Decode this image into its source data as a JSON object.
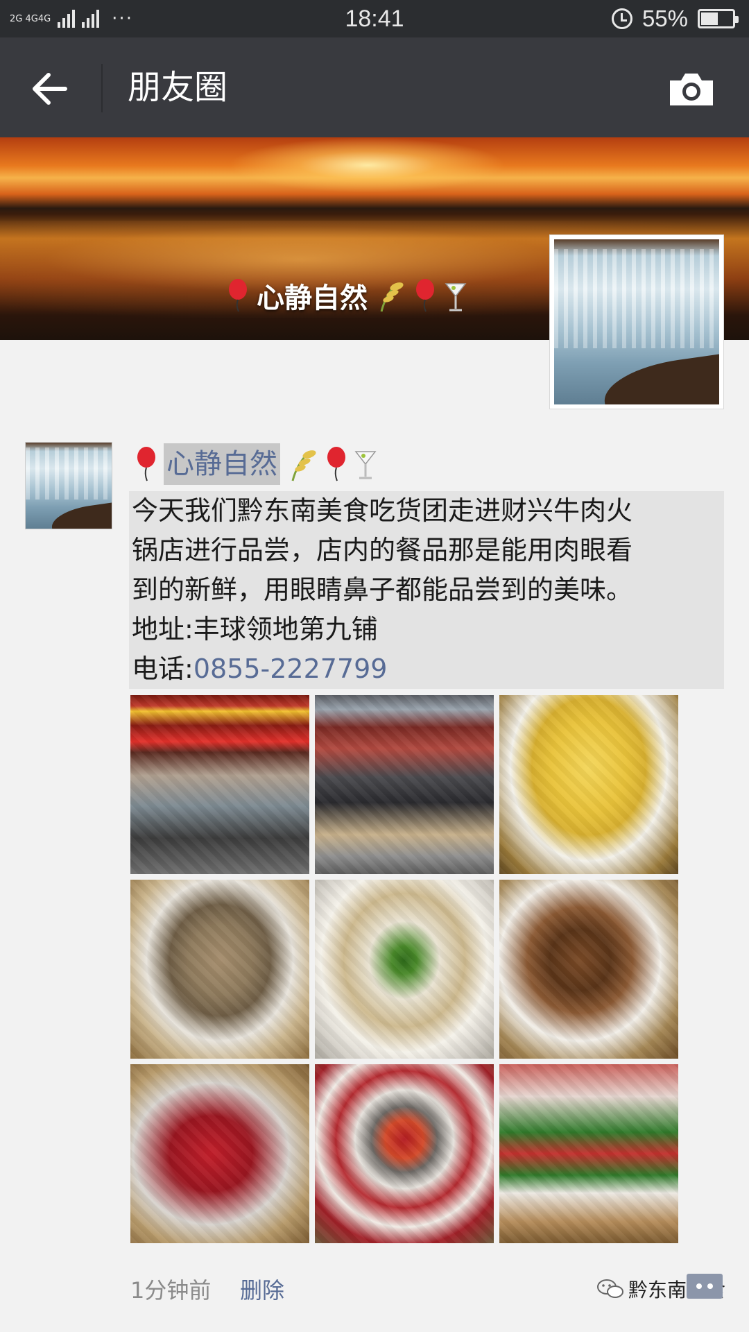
{
  "status_bar": {
    "network_label": "2G 4G4G",
    "time": "18:41",
    "battery_percent": "55%",
    "battery_level": 0.55
  },
  "nav": {
    "back_icon": "arrow-left-icon",
    "title": "朋友圈",
    "camera_icon": "camera-icon"
  },
  "cover": {
    "name": "心静自然",
    "emoji": [
      "balloon",
      "rice-ear",
      "balloon",
      "cocktail"
    ]
  },
  "post": {
    "author": "心静自然",
    "lines": [
      "今天我们黔东南美食吃货团走进财兴牛肉火",
      "锅店进行品尝，店内的餐品那是能用肉眼看",
      "到的新鲜，用眼睛鼻子都能品尝到的美味。",
      "地址:丰球领地第九铺"
    ],
    "phone_label": "电话:",
    "phone_number": "0855-2227799",
    "photos": [
      "photo-1",
      "photo-2",
      "photo-3",
      "photo-4",
      "photo-5",
      "photo-6",
      "photo-7",
      "photo-8",
      "photo-9"
    ],
    "time": "1分钟前",
    "delete": "删除"
  },
  "watermark": "黔东南美食",
  "colors": {
    "nav_bg": "#393a3f",
    "link": "#576b95",
    "page_bg": "#f2f2f2"
  }
}
